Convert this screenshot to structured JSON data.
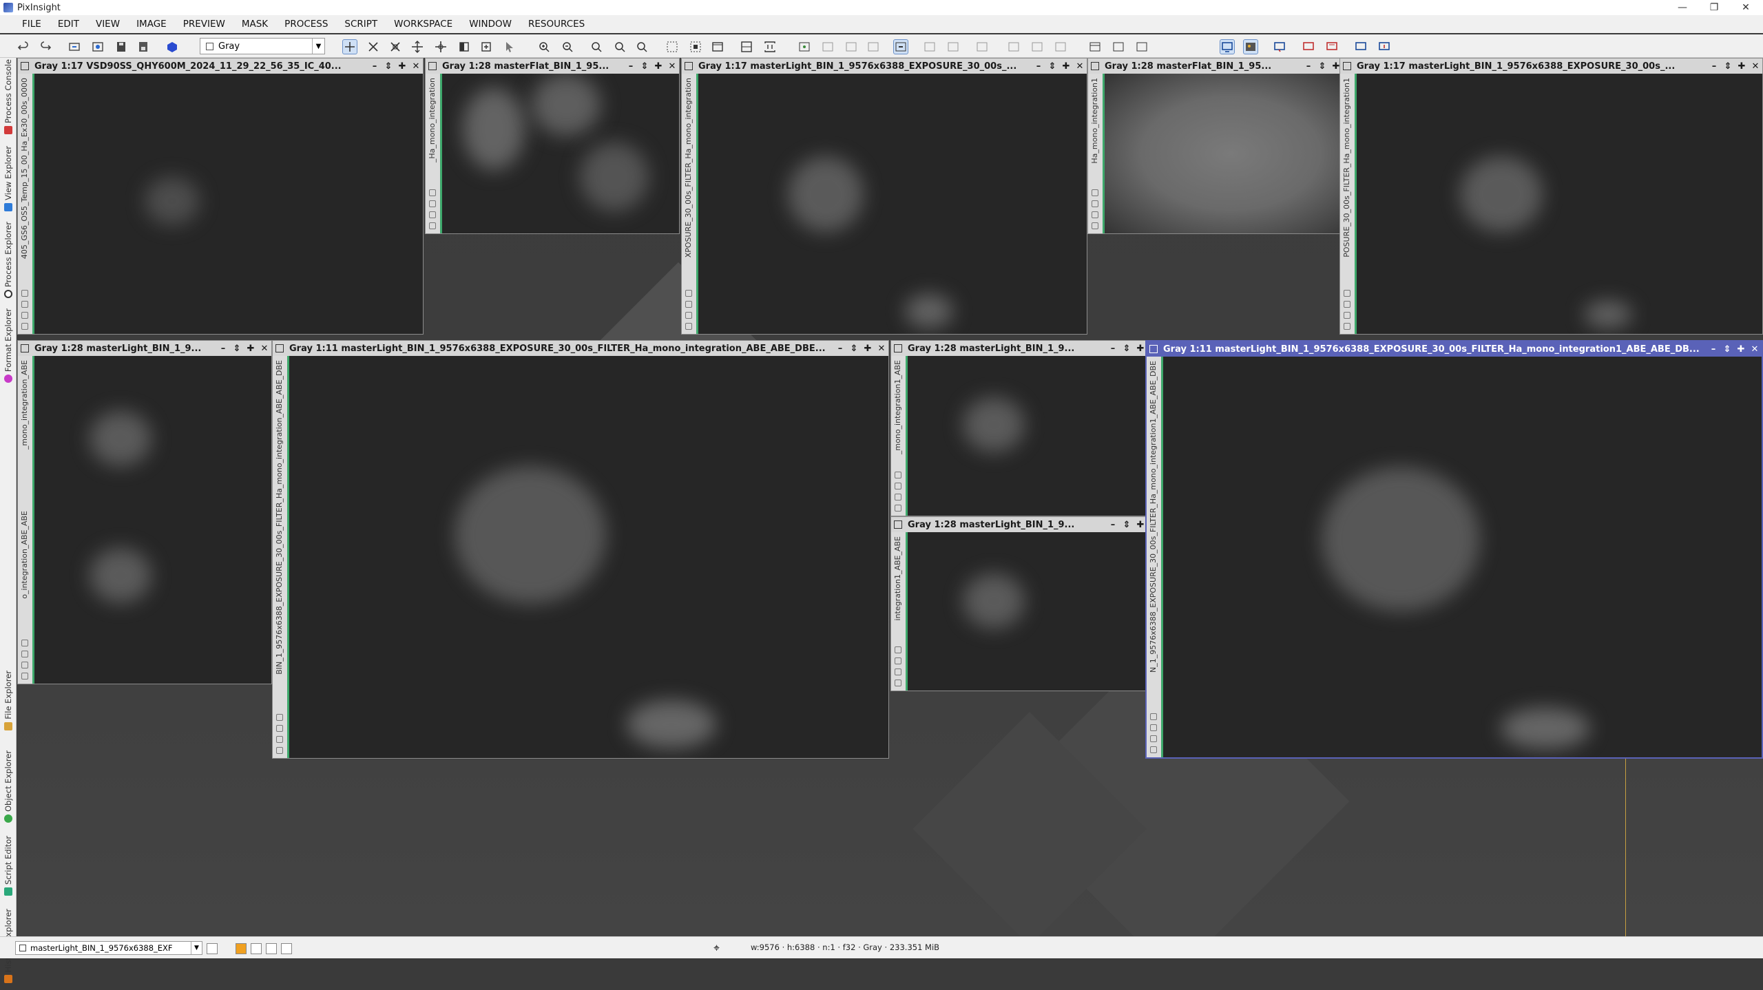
{
  "app": {
    "title": "PixInsight"
  },
  "window_controls": [
    "—",
    "❐",
    "✕"
  ],
  "menu": [
    "FILE",
    "EDIT",
    "VIEW",
    "IMAGE",
    "PREVIEW",
    "MASK",
    "PROCESS",
    "SCRIPT",
    "WORKSPACE",
    "WINDOW",
    "RESOURCES"
  ],
  "toolbar": {
    "channel_select": "Gray"
  },
  "side_tabs": [
    "Process Console",
    "View Explorer",
    "Process Explorer",
    "Format Explorer",
    "File Explorer",
    "Object Explorer",
    "Script Editor",
    "History Explorer"
  ],
  "windows": [
    {
      "title": "Gray 1:17 VSD90SS_QHY600M_2024_11_29_22_56_35_IC_40...",
      "side": "405_GS6_OS5_Temp_15_00_Ha_Ex30_00s_0000"
    },
    {
      "title": "Gray 1:28 masterFlat_BIN_1_95...",
      "side": "_Ha_mono_integration"
    },
    {
      "title": "Gray 1:17 masterLight_BIN_1_9576x6388_EXPOSURE_30_00s_...",
      "side": "XPOSURE_30_00s_FILTER_Ha_mono_integration"
    },
    {
      "title": "Gray 1:28 masterFlat_BIN_1_95...",
      "side": "Ha_mono_integration1"
    },
    {
      "title": "Gray 1:17 masterLight_BIN_1_9576x6388_EXPOSURE_30_00s_...",
      "side": "POSURE_30_00s_FILTER_Ha_mono_integration1"
    },
    {
      "title": "Gray 1:28 masterLight_BIN_1_9...",
      "side": "_mono_integration_ABE"
    },
    {
      "title": "Gray 1:11 masterLight_BIN_1_9576x6388_EXPOSURE_30_00s_FILTER_Ha_mono_integration_ABE_ABE_DBE...",
      "side": "BIN_1_9576x6388_EXPOSURE_30_00s_FILTER_Ha_mono_integration_ABE_ABE_DBE"
    },
    {
      "title": "Gray 1:28 masterLight_BIN_1_9...",
      "side": "o_integration_ABE_ABE"
    },
    {
      "title": "Gray 1:28 masterLight_BIN_1_9...",
      "side": "_mono_integration1_ABE"
    },
    {
      "title": "Gray 1:28 masterLight_BIN_1_9...",
      "side": "integration1_ABE_ABE"
    },
    {
      "title": "Gray 1:11 masterLight_BIN_1_9576x6388_EXPOSURE_30_00s_FILTER_Ha_mono_integration1_ABE_ABE_DB...",
      "side": "N_1_9576x6388_EXPOSURE_30_00s_FILTER_Ha_mono_integration1_ABE_ABE_DBE"
    }
  ],
  "statusbar": {
    "view_select": "masterLight_BIN_1_9576x6388_EXF",
    "image_info": "w:9576 · h:6388 · n:1 · f32 · Gray · 233.351 MiB"
  }
}
